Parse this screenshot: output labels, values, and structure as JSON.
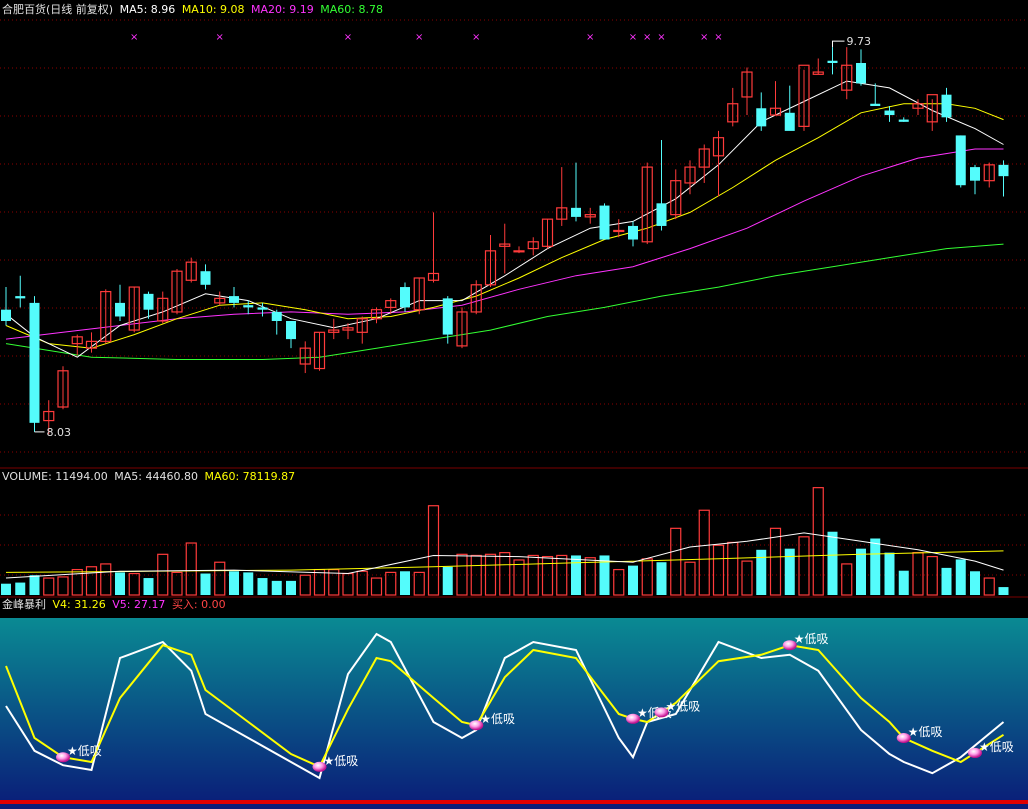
{
  "colors": {
    "up": "#ff3b3b",
    "down": "#54fcfc",
    "ma5": "#ffffff",
    "ma10": "#ffff00",
    "ma20": "#ff33ff",
    "ma60": "#33ff33",
    "grid": "#8b0000",
    "panel3_top": "#0a8a93",
    "panel3_bottom": "#0a1b78"
  },
  "header": {
    "title": "合肥百货(日线 前复权)",
    "ma5": "MA5: 8.96",
    "ma10": "MA10: 9.08",
    "ma20": "MA20: 9.19",
    "ma60": "MA60: 8.78"
  },
  "volume_header": {
    "volume": "VOLUME: 11494.00",
    "ma5": "MA5: 44460.80",
    "ma60": "MA60: 78119.87"
  },
  "indicator_header": {
    "name": "金峰暴利",
    "v4": "V4: 31.26",
    "v5": "V5: 27.17",
    "buy": "买入: 0.00"
  },
  "chart_data": [
    {
      "type": "candlestick",
      "annotations": {
        "high": "9.73",
        "low": "8.03"
      },
      "ylim": [
        7.95,
        9.85
      ],
      "marker_symbol": "×",
      "markers_at": [
        9,
        15,
        24,
        29,
        33,
        41,
        44,
        45,
        46,
        49,
        50
      ],
      "candles": [
        [
          8.57,
          8.67,
          8.5,
          8.52
        ],
        [
          8.63,
          8.72,
          8.58,
          8.62
        ],
        [
          8.6,
          8.63,
          8.03,
          8.07
        ],
        [
          8.08,
          8.17,
          8.02,
          8.12
        ],
        [
          8.14,
          8.32,
          8.13,
          8.3
        ],
        [
          8.42,
          8.46,
          8.37,
          8.45
        ],
        [
          8.4,
          8.47,
          8.38,
          8.43
        ],
        [
          8.43,
          8.66,
          8.42,
          8.65
        ],
        [
          8.6,
          8.68,
          8.52,
          8.54
        ],
        [
          8.48,
          8.67,
          8.47,
          8.67
        ],
        [
          8.64,
          8.65,
          8.53,
          8.57
        ],
        [
          8.52,
          8.65,
          8.51,
          8.62
        ],
        [
          8.56,
          8.75,
          8.55,
          8.74
        ],
        [
          8.7,
          8.8,
          8.69,
          8.78
        ],
        [
          8.74,
          8.77,
          8.66,
          8.68
        ],
        [
          8.6,
          8.65,
          8.59,
          8.62
        ],
        [
          8.63,
          8.67,
          8.58,
          8.6
        ],
        [
          8.59,
          8.61,
          8.55,
          8.58
        ],
        [
          8.58,
          8.6,
          8.54,
          8.57
        ],
        [
          8.56,
          8.57,
          8.46,
          8.52
        ],
        [
          8.52,
          8.52,
          8.4,
          8.44
        ],
        [
          8.33,
          8.43,
          8.29,
          8.4
        ],
        [
          8.31,
          8.47,
          8.3,
          8.47
        ],
        [
          8.47,
          8.53,
          8.44,
          8.48
        ],
        [
          8.48,
          8.51,
          8.44,
          8.49
        ],
        [
          8.47,
          8.54,
          8.42,
          8.53
        ],
        [
          8.53,
          8.58,
          8.51,
          8.57
        ],
        [
          8.58,
          8.62,
          8.55,
          8.61
        ],
        [
          8.67,
          8.69,
          8.56,
          8.58
        ],
        [
          8.57,
          8.71,
          8.55,
          8.71
        ],
        [
          8.7,
          9.0,
          8.69,
          8.73
        ],
        [
          8.62,
          8.63,
          8.42,
          8.46
        ],
        [
          8.41,
          8.58,
          8.4,
          8.56
        ],
        [
          8.56,
          8.7,
          8.55,
          8.68
        ],
        [
          8.68,
          8.9,
          8.67,
          8.83
        ],
        [
          8.85,
          8.95,
          8.73,
          8.86
        ],
        [
          8.83,
          8.85,
          8.82,
          8.83
        ],
        [
          8.84,
          8.89,
          8.81,
          8.87
        ],
        [
          8.85,
          8.97,
          8.84,
          8.97
        ],
        [
          8.97,
          9.2,
          8.94,
          9.02
        ],
        [
          9.02,
          9.22,
          8.96,
          8.98
        ],
        [
          8.98,
          9.02,
          8.95,
          8.99
        ],
        [
          9.03,
          9.04,
          8.96,
          8.88
        ],
        [
          8.92,
          8.97,
          8.89,
          8.92
        ],
        [
          8.94,
          8.96,
          8.85,
          8.88
        ],
        [
          8.87,
          9.22,
          8.86,
          9.2
        ],
        [
          9.04,
          9.32,
          8.92,
          8.94
        ],
        [
          8.99,
          9.19,
          8.97,
          9.14
        ],
        [
          9.13,
          9.23,
          9.08,
          9.2
        ],
        [
          9.2,
          9.3,
          9.13,
          9.28
        ],
        [
          9.25,
          9.36,
          9.07,
          9.33
        ],
        [
          9.4,
          9.55,
          9.38,
          9.48
        ],
        [
          9.51,
          9.64,
          9.43,
          9.62
        ],
        [
          9.46,
          9.53,
          9.36,
          9.38
        ],
        [
          9.43,
          9.58,
          9.43,
          9.46
        ],
        [
          9.44,
          9.56,
          9.4,
          9.36
        ],
        [
          9.38,
          9.63,
          9.36,
          9.65
        ],
        [
          9.61,
          9.68,
          9.61,
          9.62
        ],
        [
          9.67,
          9.73,
          9.61,
          9.66
        ],
        [
          9.54,
          9.73,
          9.5,
          9.65
        ],
        [
          9.66,
          9.72,
          9.56,
          9.57
        ],
        [
          9.48,
          9.57,
          9.47,
          9.47
        ],
        [
          9.45,
          9.47,
          9.4,
          9.43
        ],
        [
          9.41,
          9.42,
          9.4,
          9.4
        ],
        [
          9.46,
          9.5,
          9.43,
          9.48
        ],
        [
          9.4,
          9.5,
          9.36,
          9.52
        ],
        [
          9.52,
          9.55,
          9.4,
          9.42
        ],
        [
          9.34,
          9.34,
          9.11,
          9.12
        ],
        [
          9.2,
          9.21,
          9.08,
          9.14
        ],
        [
          9.14,
          9.22,
          9.11,
          9.21
        ],
        [
          9.21,
          9.23,
          9.07,
          9.16
        ]
      ],
      "ma_points": {
        "ma5": [
          [
            0,
            8.55
          ],
          [
            2,
            8.45
          ],
          [
            5,
            8.36
          ],
          [
            8,
            8.5
          ],
          [
            11,
            8.56
          ],
          [
            14,
            8.64
          ],
          [
            17,
            8.61
          ],
          [
            20,
            8.53
          ],
          [
            23,
            8.49
          ],
          [
            26,
            8.53
          ],
          [
            29,
            8.61
          ],
          [
            32,
            8.61
          ],
          [
            35,
            8.72
          ],
          [
            38,
            8.84
          ],
          [
            41,
            8.93
          ],
          [
            44,
            8.96
          ],
          [
            47,
            9.06
          ],
          [
            50,
            9.21
          ],
          [
            53,
            9.4
          ],
          [
            56,
            9.49
          ],
          [
            59,
            9.58
          ],
          [
            62,
            9.55
          ],
          [
            65,
            9.45
          ],
          [
            68,
            9.37
          ],
          [
            70,
            9.3
          ]
        ],
        "ma10": [
          [
            0,
            8.5
          ],
          [
            3,
            8.42
          ],
          [
            6,
            8.4
          ],
          [
            9,
            8.46
          ],
          [
            12,
            8.53
          ],
          [
            15,
            8.59
          ],
          [
            18,
            8.6
          ],
          [
            21,
            8.57
          ],
          [
            24,
            8.53
          ],
          [
            27,
            8.54
          ],
          [
            30,
            8.58
          ],
          [
            33,
            8.63
          ],
          [
            36,
            8.71
          ],
          [
            39,
            8.8
          ],
          [
            42,
            8.88
          ],
          [
            45,
            8.93
          ],
          [
            48,
            9.0
          ],
          [
            51,
            9.11
          ],
          [
            54,
            9.23
          ],
          [
            57,
            9.33
          ],
          [
            60,
            9.44
          ],
          [
            63,
            9.48
          ],
          [
            66,
            9.48
          ],
          [
            68,
            9.46
          ],
          [
            70,
            9.41
          ]
        ],
        "ma20": [
          [
            0,
            8.44
          ],
          [
            4,
            8.47
          ],
          [
            8,
            8.5
          ],
          [
            12,
            8.53
          ],
          [
            16,
            8.55
          ],
          [
            20,
            8.56
          ],
          [
            24,
            8.55
          ],
          [
            28,
            8.56
          ],
          [
            32,
            8.59
          ],
          [
            36,
            8.66
          ],
          [
            40,
            8.72
          ],
          [
            44,
            8.76
          ],
          [
            48,
            8.84
          ],
          [
            52,
            8.93
          ],
          [
            56,
            9.05
          ],
          [
            60,
            9.16
          ],
          [
            64,
            9.24
          ],
          [
            68,
            9.28
          ],
          [
            70,
            9.28
          ]
        ],
        "ma60": [
          [
            0,
            8.42
          ],
          [
            6,
            8.36
          ],
          [
            12,
            8.35
          ],
          [
            18,
            8.35
          ],
          [
            22,
            8.36
          ],
          [
            26,
            8.4
          ],
          [
            30,
            8.44
          ],
          [
            34,
            8.48
          ],
          [
            38,
            8.54
          ],
          [
            42,
            8.58
          ],
          [
            46,
            8.63
          ],
          [
            50,
            8.67
          ],
          [
            54,
            8.72
          ],
          [
            58,
            8.76
          ],
          [
            62,
            8.8
          ],
          [
            66,
            8.84
          ],
          [
            70,
            8.86
          ]
        ]
      }
    },
    {
      "type": "bar",
      "ylim": [
        0,
        200000
      ],
      "values": [
        20000,
        22000,
        35000,
        30000,
        32000,
        45000,
        50000,
        55000,
        40000,
        38000,
        30000,
        72000,
        40000,
        92000,
        38000,
        58000,
        42000,
        40000,
        30000,
        25000,
        25000,
        35000,
        45000,
        45000,
        38000,
        42000,
        30000,
        40000,
        42000,
        40000,
        158000,
        50000,
        72000,
        70000,
        72000,
        75000,
        62000,
        70000,
        68000,
        70000,
        70000,
        66000,
        70000,
        45000,
        52000,
        64000,
        58000,
        118000,
        58000,
        150000,
        88000,
        93000,
        60000,
        80000,
        118000,
        82000,
        103000,
        190000,
        112000,
        55000,
        82000,
        100000,
        75000,
        43000,
        75000,
        68000,
        48000,
        63000,
        42000,
        30000,
        14000
      ],
      "ma5": [
        [
          0,
          30000
        ],
        [
          8,
          42000
        ],
        [
          16,
          44000
        ],
        [
          24,
          38000
        ],
        [
          30,
          70000
        ],
        [
          36,
          68000
        ],
        [
          44,
          58000
        ],
        [
          48,
          85000
        ],
        [
          52,
          95000
        ],
        [
          56,
          110000
        ],
        [
          60,
          95000
        ],
        [
          64,
          80000
        ],
        [
          68,
          60000
        ],
        [
          70,
          44000
        ]
      ],
      "ma60": [
        [
          0,
          40000
        ],
        [
          10,
          42000
        ],
        [
          20,
          44000
        ],
        [
          30,
          50000
        ],
        [
          40,
          57000
        ],
        [
          50,
          64000
        ],
        [
          60,
          72000
        ],
        [
          70,
          78000
        ]
      ]
    },
    {
      "type": "line",
      "ylim": [
        0,
        100
      ],
      "marker_label": "★低吸",
      "signals_at": [
        4,
        22,
        33,
        44,
        46,
        55,
        63,
        68
      ],
      "series": [
        {
          "name": "V4",
          "x": [
            0,
            2,
            4,
            6,
            8,
            11,
            13,
            14,
            17,
            20,
            22,
            24,
            26,
            27,
            30,
            32,
            33,
            35,
            37,
            40,
            43,
            44,
            45,
            47,
            50,
            53,
            55,
            57,
            60,
            62,
            63,
            65,
            67,
            70
          ],
          "values": [
            75,
            30,
            18,
            15,
            55,
            88,
            82,
            60,
            40,
            20,
            12,
            48,
            80,
            78,
            55,
            40,
            38,
            68,
            85,
            80,
            45,
            42,
            40,
            52,
            78,
            82,
            88,
            85,
            55,
            40,
            30,
            22,
            15,
            32
          ]
        },
        {
          "name": "V5",
          "x": [
            0,
            2,
            4,
            6,
            8,
            11,
            13,
            14,
            17,
            20,
            22,
            24,
            26,
            27,
            30,
            32,
            33,
            35,
            37,
            40,
            43,
            44,
            45,
            47,
            50,
            53,
            55,
            57,
            60,
            62,
            63,
            65,
            67,
            70
          ],
          "values": [
            50,
            22,
            13,
            10,
            80,
            90,
            72,
            45,
            30,
            15,
            5,
            70,
            95,
            90,
            40,
            30,
            35,
            80,
            90,
            85,
            30,
            18,
            40,
            45,
            90,
            80,
            82,
            72,
            35,
            20,
            15,
            8,
            18,
            40
          ]
        }
      ]
    }
  ]
}
